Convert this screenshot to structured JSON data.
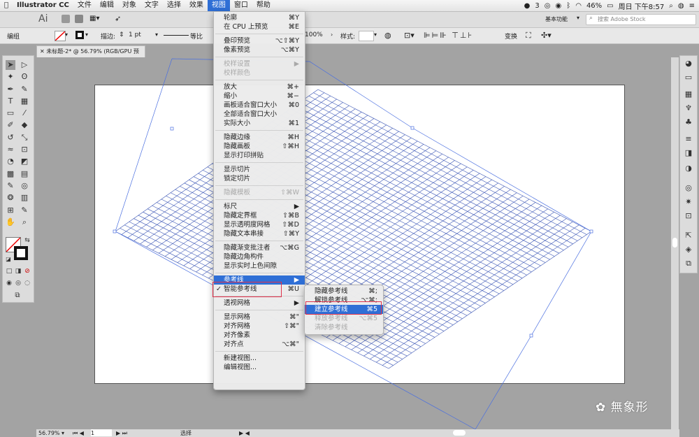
{
  "menubar": {
    "app": "Illustrator CC",
    "items": [
      "文件",
      "编辑",
      "对象",
      "文字",
      "选择",
      "效果",
      "视图",
      "窗口",
      "帮助"
    ],
    "active": "视图",
    "status": {
      "notif": "3",
      "battery": "46%",
      "clock": "周日 下午8:57"
    }
  },
  "appbar": {
    "logo": "Ai",
    "workspace": "基本功能",
    "stock_placeholder": "搜索 Adobe Stock"
  },
  "controlbar": {
    "selection": "编组",
    "stroke_label": "描边:",
    "stroke_value": "1 pt",
    "stroke_style": "等比",
    "opacity": "100%",
    "style_label": "样式:",
    "transform": "变换"
  },
  "document": {
    "tab": "未标题-2* @ 56.79% (RGB/GPU 预览)"
  },
  "status": {
    "zoom": "56.79%",
    "page": "1",
    "tool": "选择"
  },
  "view_menu": [
    {
      "label": "轮廓",
      "shortcut": "⌘Y"
    },
    {
      "label": "在 CPU 上预览",
      "shortcut": "⌘E"
    },
    {
      "sep": true
    },
    {
      "label": "叠印预览",
      "shortcut": "⌥⇧⌘Y"
    },
    {
      "label": "像素预览",
      "shortcut": "⌥⌘Y"
    },
    {
      "sep": true
    },
    {
      "label": "校样设置",
      "shortcut": "▶",
      "disabled": true
    },
    {
      "label": "校样颜色",
      "shortcut": "",
      "disabled": true
    },
    {
      "sep": true
    },
    {
      "label": "放大",
      "shortcut": "⌘+"
    },
    {
      "label": "缩小",
      "shortcut": "⌘−"
    },
    {
      "label": "画板适合窗口大小",
      "shortcut": "⌘0"
    },
    {
      "label": "全部适合窗口大小",
      "shortcut": ""
    },
    {
      "label": "实际大小",
      "shortcut": "⌘1"
    },
    {
      "sep": true
    },
    {
      "label": "隐藏边缘",
      "shortcut": "⌘H"
    },
    {
      "label": "隐藏画板",
      "shortcut": "⇧⌘H"
    },
    {
      "label": "显示打印拼贴",
      "shortcut": ""
    },
    {
      "sep": true
    },
    {
      "label": "显示切片",
      "shortcut": ""
    },
    {
      "label": "锁定切片",
      "shortcut": ""
    },
    {
      "sep": true
    },
    {
      "label": "隐藏模板",
      "shortcut": "⇧⌘W",
      "disabled": true
    },
    {
      "sep": true
    },
    {
      "label": "标尺",
      "shortcut": "▶"
    },
    {
      "label": "隐藏定界框",
      "shortcut": "⇧⌘B"
    },
    {
      "label": "显示透明度网格",
      "shortcut": "⇧⌘D"
    },
    {
      "label": "隐藏文本串接",
      "shortcut": "⇧⌘Y"
    },
    {
      "sep": true
    },
    {
      "label": "隐藏渐变批注者",
      "shortcut": "⌥⌘G"
    },
    {
      "label": "隐藏边角构件",
      "shortcut": ""
    },
    {
      "label": "显示实时上色间隙",
      "shortcut": ""
    },
    {
      "sep": true
    },
    {
      "label": "参考线",
      "shortcut": "▶",
      "highlight": true
    },
    {
      "label": "智能参考线",
      "shortcut": "⌘U",
      "checked": true
    },
    {
      "sep": true
    },
    {
      "label": "透视网格",
      "shortcut": "▶"
    },
    {
      "sep": true
    },
    {
      "label": "显示网格",
      "shortcut": "⌘\""
    },
    {
      "label": "对齐网格",
      "shortcut": "⇧⌘\""
    },
    {
      "label": "对齐像素",
      "shortcut": ""
    },
    {
      "label": "对齐点",
      "shortcut": "⌥⌘\""
    },
    {
      "sep": true
    },
    {
      "label": "新建视图...",
      "shortcut": ""
    },
    {
      "label": "编辑视图...",
      "shortcut": ""
    }
  ],
  "guides_submenu": [
    {
      "label": "隐藏参考线",
      "shortcut": "⌘;"
    },
    {
      "label": "解锁参考线",
      "shortcut": "⌥⌘;"
    },
    {
      "label": "建立参考线",
      "shortcut": "⌘5",
      "highlight": true
    },
    {
      "label": "释放参考线",
      "shortcut": "⌥⌘5",
      "disabled": true
    },
    {
      "label": "清除参考线",
      "shortcut": "",
      "disabled": true
    }
  ],
  "watermark": "無象形",
  "colors": {
    "accent": "#2f6fd6",
    "grid": "#3a55b5",
    "highlight_box": "#e0314b"
  }
}
